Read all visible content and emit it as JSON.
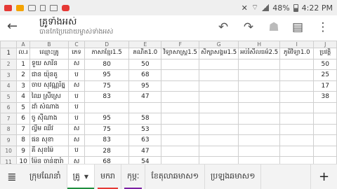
{
  "status_bar": {
    "battery": "48%",
    "time": "4:22 PM"
  },
  "toolbar": {
    "title": "គ្រូទាំងអស់",
    "subtitle": "បានកែប្រែដោយម្ចាស់ទាំងអស់"
  },
  "sheet": {
    "column_letters": [
      "A",
      "B",
      "C",
      "D",
      "E",
      "F",
      "G",
      "H",
      "I",
      "J"
    ],
    "header_row": [
      "ល.រ",
      "ឈ្មោះគ្រូ",
      "ភេទ",
      "ភាសាខ្មែរ1.5",
      "គណិត1.0",
      "វិទ្យាសាស្ត្រ1.5",
      "សិក្សាសង្គម1.5",
      "អប់រំសីលធម៌2.5",
      "ភូមិវិទ្យា1.0",
      "ប្រវត្តិ"
    ],
    "rows": [
      {
        "n": "1",
        "name": "ទួយ សារិន",
        "sex": "ស",
        "d": "80",
        "e": "50",
        "j": "50"
      },
      {
        "n": "2",
        "name": "ជាន យ៉ុនតូ",
        "sex": "ប",
        "d": "95",
        "e": "68",
        "j": "25"
      },
      {
        "n": "3",
        "name": "ចាប សុវណ្ណរ័ត្ន",
        "sex": "ស",
        "d": "75",
        "e": "95",
        "j": "17"
      },
      {
        "n": "4",
        "name": "ឈៃ ស្រីស្រេ",
        "sex": "ប",
        "d": "83",
        "e": "47",
        "j": "38"
      },
      {
        "n": "5",
        "name": "ដាំ សំណាង",
        "sex": "ប",
        "d": "",
        "e": "",
        "j": ""
      },
      {
        "n": "6",
        "name": "ចូ ស៊ីណាង",
        "sex": "ប",
        "d": "95",
        "e": "58",
        "j": ""
      },
      {
        "n": "7",
        "name": "ល្វីម ឈីវ",
        "sex": "ស",
        "d": "75",
        "e": "53",
        "j": ""
      },
      {
        "n": "8",
        "name": "ផន សុខា",
        "sex": "ស",
        "d": "83",
        "e": "63",
        "j": ""
      },
      {
        "n": "9",
        "name": "គី សុខម៉ៃ",
        "sex": "ប",
        "d": "28",
        "e": "47",
        "j": ""
      },
      {
        "n": "10",
        "name": "ម៉ែន ចាន់ឌារ៉ា",
        "sex": "ស",
        "d": "68",
        "e": "54",
        "j": ""
      },
      {
        "n": "11",
        "name": "ខន បុប្ផា",
        "sex": "ប",
        "d": "83",
        "e": "53",
        "j": ""
      }
    ]
  },
  "tabs": {
    "items": [
      "ក្រុមណែនាំ",
      "គ្រូ",
      "មករា",
      "កុម្ភៈ",
      "ខែតុលាឆមាស១",
      "ប្រឡងឆមាស១"
    ]
  },
  "icons": {
    "back": "arrow-back-icon",
    "undo": "undo-icon",
    "redo": "redo-icon",
    "share": "add-person-icon",
    "comment": "comment-icon",
    "more": "more-vert-icon",
    "menu": "menu-icon",
    "add": "add-icon"
  }
}
